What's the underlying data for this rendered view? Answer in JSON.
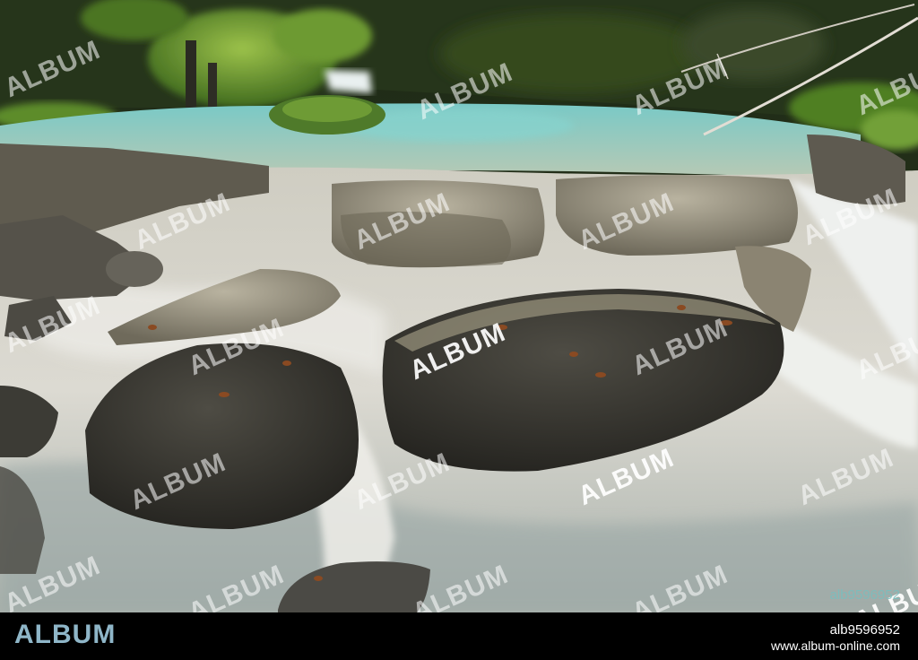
{
  "photo": {
    "subject": "",
    "colors": {
      "moss": "#5f8a2b",
      "pool": "#7fc4c0",
      "rock": "#3b3a35",
      "foam": "#e4e2dc"
    }
  },
  "watermarks": {
    "text": "ALBUM",
    "corner_id": "alb9596952"
  },
  "footer": {
    "logo": "ALBUM",
    "image_id": "alb9596952",
    "url": "www.album-online.com"
  }
}
